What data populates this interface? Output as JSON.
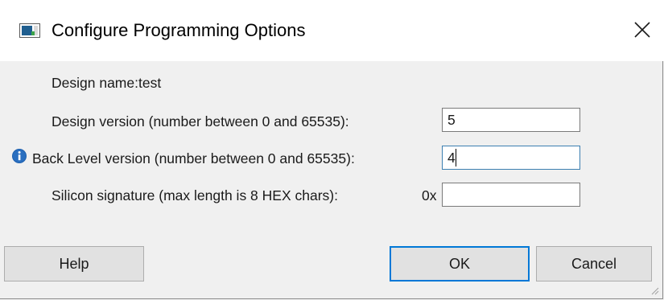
{
  "window": {
    "title": "Configure Programming Options",
    "close_glyph": "✕",
    "icon": "app-window-icon"
  },
  "form": {
    "design_name_label": "Design name:test",
    "design_version_label": "Design version (number between 0 and 65535):",
    "design_version_value": "5",
    "back_level_label": "Back Level version (number between 0 and 65535):",
    "back_level_value": "4",
    "back_level_info_icon": "info-icon",
    "silicon_signature_label": "Silicon signature (max length is 8 HEX chars):",
    "silicon_signature_prefix": "0x",
    "silicon_signature_value": ""
  },
  "buttons": {
    "help": "Help",
    "ok": "OK",
    "cancel": "Cancel"
  },
  "colors": {
    "info_blue": "#1c5fae",
    "focus_blue": "#0078d7"
  }
}
